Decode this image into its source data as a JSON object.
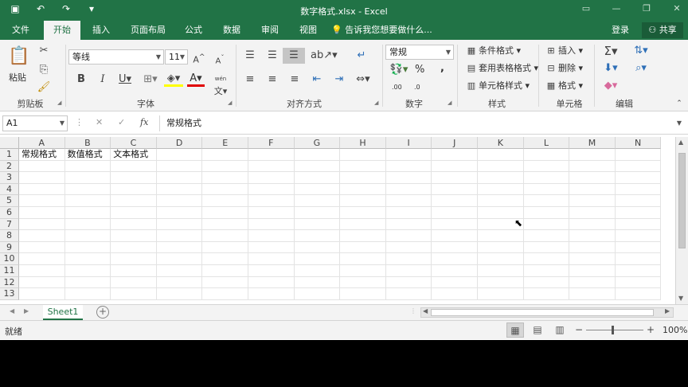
{
  "window": {
    "title": "数字格式.xlsx - Excel",
    "qat_icons": [
      "save-icon",
      "undo-icon",
      "redo-icon",
      "customize-qat-icon"
    ]
  },
  "tabs": [
    {
      "label": "文件",
      "active": false
    },
    {
      "label": "开始",
      "active": true
    },
    {
      "label": "插入",
      "active": false
    },
    {
      "label": "页面布局",
      "active": false
    },
    {
      "label": "公式",
      "active": false
    },
    {
      "label": "数据",
      "active": false
    },
    {
      "label": "审阅",
      "active": false
    },
    {
      "label": "视图",
      "active": false
    }
  ],
  "tell_me": "告诉我您想要做什么...",
  "login": "登录",
  "share": "共享",
  "ribbon": {
    "clipboard": {
      "label": "剪贴板",
      "paste": "粘贴"
    },
    "font": {
      "label": "字体",
      "name": "等线",
      "size": "11",
      "phonetic": "wén"
    },
    "alignment": {
      "label": "对齐方式"
    },
    "number": {
      "label": "数字",
      "format": "常规",
      "percent": "%",
      "comma": ",",
      "inc_decimal": ".00",
      "dec_decimal": ".0"
    },
    "styles": {
      "label": "样式",
      "conditional": "条件格式",
      "table": "套用表格格式",
      "cell_styles": "单元格样式"
    },
    "cells": {
      "label": "单元格",
      "insert": "插入",
      "delete": "删除",
      "format": "格式"
    },
    "editing": {
      "label": "编辑"
    }
  },
  "formula_bar": {
    "name_box": "A1",
    "cancel": "✕",
    "enter": "✓",
    "fx": "fx",
    "content": "常规格式"
  },
  "columns": [
    "A",
    "B",
    "C",
    "D",
    "E",
    "F",
    "G",
    "H",
    "I",
    "J",
    "K",
    "L",
    "M",
    "N"
  ],
  "rows": [
    "1",
    "2",
    "3",
    "4",
    "5",
    "6",
    "7",
    "8",
    "9",
    "10",
    "11",
    "12",
    "13"
  ],
  "cells": {
    "A1": "常规格式",
    "B1": "数值格式",
    "C1": "文本格式"
  },
  "sheets": [
    {
      "name": "Sheet1",
      "active": true
    }
  ],
  "status": {
    "ready": "就绪",
    "zoom": "100%"
  },
  "colors": {
    "accent": "#217346"
  }
}
